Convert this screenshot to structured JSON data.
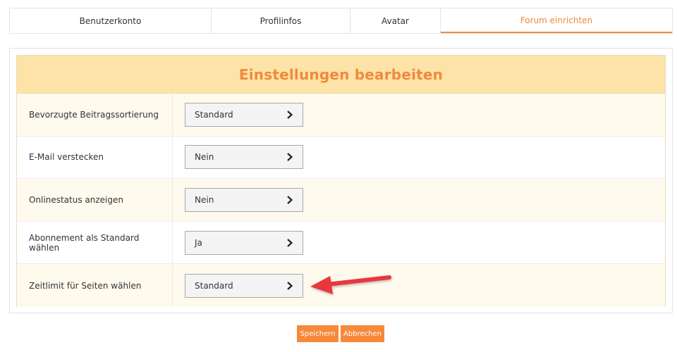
{
  "tabs": [
    {
      "label": "Benutzerkonto",
      "active": false
    },
    {
      "label": "Profilinfos",
      "active": false
    },
    {
      "label": "Avatar",
      "active": false
    },
    {
      "label": "Forum einrichten",
      "active": true
    }
  ],
  "panel": {
    "title": "Einstellungen bearbeiten",
    "rows": [
      {
        "label": "Bevorzugte Beitragssortierung",
        "value": "Standard"
      },
      {
        "label": "E-Mail verstecken",
        "value": "Nein"
      },
      {
        "label": "Onlinestatus anzeigen",
        "value": "Nein"
      },
      {
        "label": "Abonnement als Standard wählen",
        "value": "Ja"
      },
      {
        "label": "Zeitlimit für Seiten wählen",
        "value": "Standard"
      }
    ]
  },
  "actions": {
    "save_label": "Speichern",
    "cancel_label": "Abbrechen"
  },
  "colors": {
    "accent": "#f08a3c",
    "header_bg": "#fde3a7",
    "annotation_arrow": "#e8373c"
  },
  "icons": {
    "select_chevron": "chevron-right-icon",
    "annotation": "red-arrow-icon"
  }
}
